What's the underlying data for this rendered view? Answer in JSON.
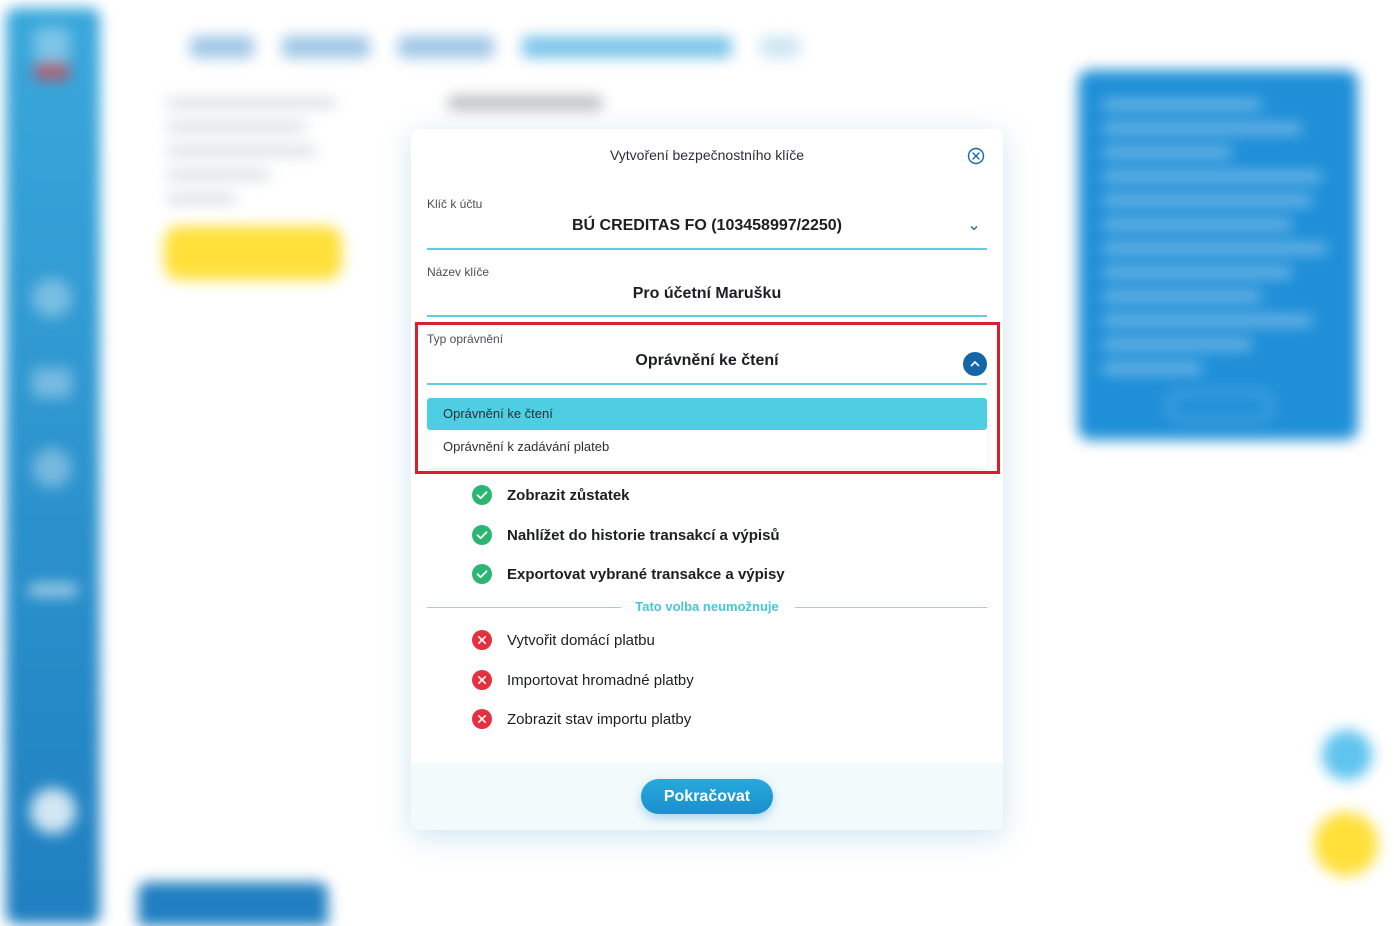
{
  "modal": {
    "title": "Vytvoření bezpečnostního klíče",
    "account_field": {
      "label": "Klíč k účtu",
      "value": "BÚ CREDITAS FO (103458997/2250)"
    },
    "name_field": {
      "label": "Název klíče",
      "value": "Pro účetní Marušku"
    },
    "type_field": {
      "label": "Typ oprávnění",
      "value": "Oprávnění ke čtení"
    },
    "dropdown_options": [
      {
        "label": "Oprávnění ke čtení",
        "selected": true
      },
      {
        "label": "Oprávnění k zadávání plateb",
        "selected": false
      }
    ],
    "allowed": [
      "Zobrazit zůstatek",
      "Nahlížet do historie transakcí a výpisů",
      "Exportovat vybrané transakce a výpisy"
    ],
    "divider_label": "Tato volba neumožnuje",
    "denied": [
      "Vytvořit domácí platbu",
      "Importovat hromadné platby",
      "Zobrazit stav importu platby"
    ],
    "continue_label": "Pokračovat"
  },
  "colors": {
    "accent": "#4fcde2",
    "primary": "#1a8fcc",
    "ok": "#2bb673",
    "deny": "#e53040",
    "highlight": "#d42030"
  },
  "icons": {
    "close": "close-circle-icon",
    "account_chevron": "chevron-down-icon",
    "type_chevron": "chevron-up-icon",
    "allowed": "check-circle-icon",
    "denied": "x-circle-icon"
  }
}
